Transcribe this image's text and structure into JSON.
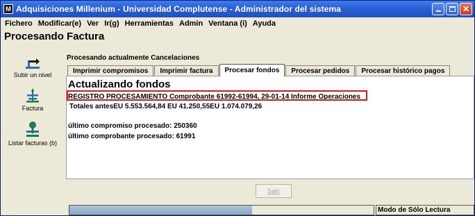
{
  "window": {
    "icon_letter": "M",
    "title": "Adquisiciones Millenium - Universidad Complutense - Administrador del sistema"
  },
  "menubar": {
    "items": [
      "Fichero",
      "Modificar(e)",
      "Ver",
      "Ir(g)",
      "Herramientas",
      "Admin",
      "Ventana (i)",
      "Ayuda"
    ]
  },
  "page": {
    "title": "Procesando Factura"
  },
  "sidebar": {
    "items": [
      {
        "label": "Subir un nivel",
        "icon": "up-level-icon"
      },
      {
        "label": "Factura",
        "icon": "invoice-icon"
      },
      {
        "label": "Listar facturas (b)",
        "icon": "list-invoices-icon"
      }
    ]
  },
  "status": {
    "text": "Procesando actualmente Cancelaciones"
  },
  "tabs": [
    {
      "label": "Imprimir compromisos",
      "active": false
    },
    {
      "label": "Imprimir factura",
      "active": false
    },
    {
      "label": "Procesar fondos",
      "active": true
    },
    {
      "label": "Procesar pedidos",
      "active": false
    },
    {
      "label": "Procesar histórico pagos",
      "active": false
    }
  ],
  "content": {
    "heading": "Actualizando fondos",
    "lines": [
      "REGISTRO PROCESAMIENTO Comprobante 61992-61994,   29-01-14 Informe Operaciones",
      " Totales antesEU 5.553.564,84  EU 41.250,55EU 1.074.079,26",
      "",
      "último compromiso procesado: 250360",
      "último comprobante procesado: 61991"
    ],
    "highlight_color": "#e0161c"
  },
  "footer": {
    "exit_label": "Salir",
    "progress_percent": 60,
    "mode_text": "Modo de Sólo Lectura"
  },
  "colors": {
    "titlebar": "#2a5fd6",
    "chrome": "#ece9d8",
    "highlight": "#e0161c"
  }
}
